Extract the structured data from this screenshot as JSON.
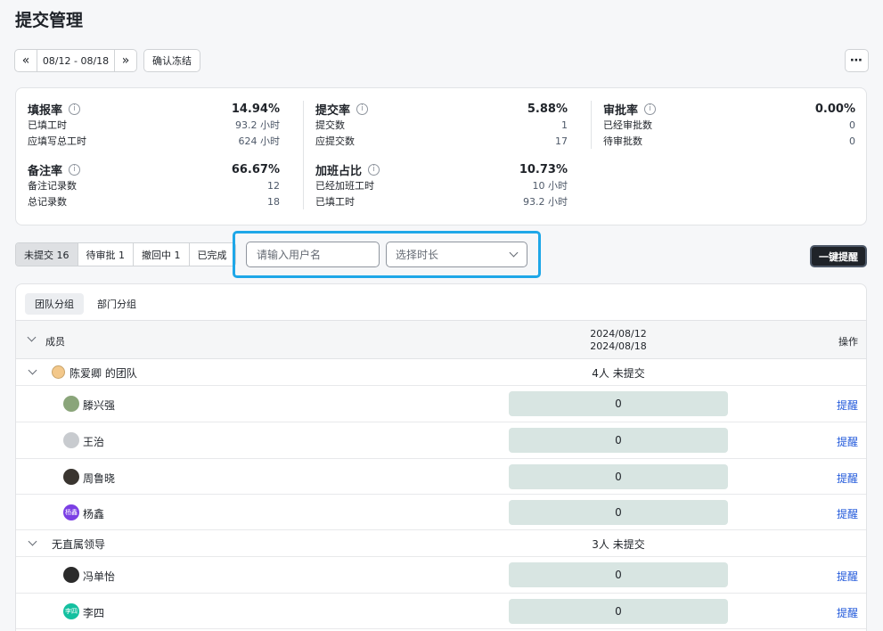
{
  "page": {
    "title": "提交管理"
  },
  "toolbar": {
    "prev_icon": "«",
    "date_range": "08/12 - 08/18",
    "next_icon": "»",
    "confirm_freeze": "确认冻结",
    "more_icon": "⋯"
  },
  "stats": {
    "fill_rate": {
      "label": "填报率",
      "value": "14.94%",
      "rows": [
        {
          "k": "已填工时",
          "v": "93.2 小时"
        },
        {
          "k": "应填写总工时",
          "v": "624 小时"
        }
      ]
    },
    "submit_rate": {
      "label": "提交率",
      "value": "5.88%",
      "rows": [
        {
          "k": "提交数",
          "v": "1"
        },
        {
          "k": "应提交数",
          "v": "17"
        }
      ]
    },
    "approve_rate": {
      "label": "审批率",
      "value": "0.00%",
      "rows": [
        {
          "k": "已经审批数",
          "v": "0"
        },
        {
          "k": "待审批数",
          "v": "0"
        }
      ]
    },
    "note_rate": {
      "label": "备注率",
      "value": "66.67%",
      "rows": [
        {
          "k": "备注记录数",
          "v": "12"
        },
        {
          "k": "总记录数",
          "v": "18"
        }
      ]
    },
    "overtime_ratio": {
      "label": "加班占比",
      "value": "10.73%",
      "rows": [
        {
          "k": "已经加班工时",
          "v": "10 小时"
        },
        {
          "k": "已填工时",
          "v": "93.2 小时"
        }
      ]
    },
    "info_icon": "i"
  },
  "filters": {
    "tabs": [
      {
        "label": "未提交 16"
      },
      {
        "label": "待审批 1"
      },
      {
        "label": "撤回中 1"
      },
      {
        "label": "已完成"
      }
    ],
    "search_placeholder": "请输入用户名",
    "duration_placeholder": "选择时长",
    "remind_all": "一键提醒"
  },
  "table": {
    "group_tabs": [
      {
        "label": "团队分组"
      },
      {
        "label": "部门分组"
      }
    ],
    "header": {
      "member": "成员",
      "date_line1": "2024/08/12",
      "date_line2": "2024/08/18",
      "action": "操作"
    },
    "groups": [
      {
        "name": "陈爱卿 的团队",
        "summary": "4人 未提交",
        "members": [
          {
            "name": "滕兴强",
            "value": "0",
            "action": "提醒"
          },
          {
            "name": "王治",
            "value": "0",
            "action": "提醒"
          },
          {
            "name": "周鲁晓",
            "value": "0",
            "action": "提醒"
          },
          {
            "name": "杨鑫",
            "value": "0",
            "action": "提醒",
            "avatar_text": "杨鑫"
          }
        ]
      },
      {
        "name": "无直属领导",
        "summary": "3人 未提交",
        "members": [
          {
            "name": "冯单怡",
            "value": "0",
            "action": "提醒"
          },
          {
            "name": "李四",
            "value": "0",
            "action": "提醒",
            "avatar_text": "李四"
          }
        ]
      }
    ]
  },
  "colors": {
    "highlight": "#1ea7e8",
    "link": "#245bdb",
    "bar": "#d8e5e2",
    "primary_dark": "#1f2329"
  }
}
